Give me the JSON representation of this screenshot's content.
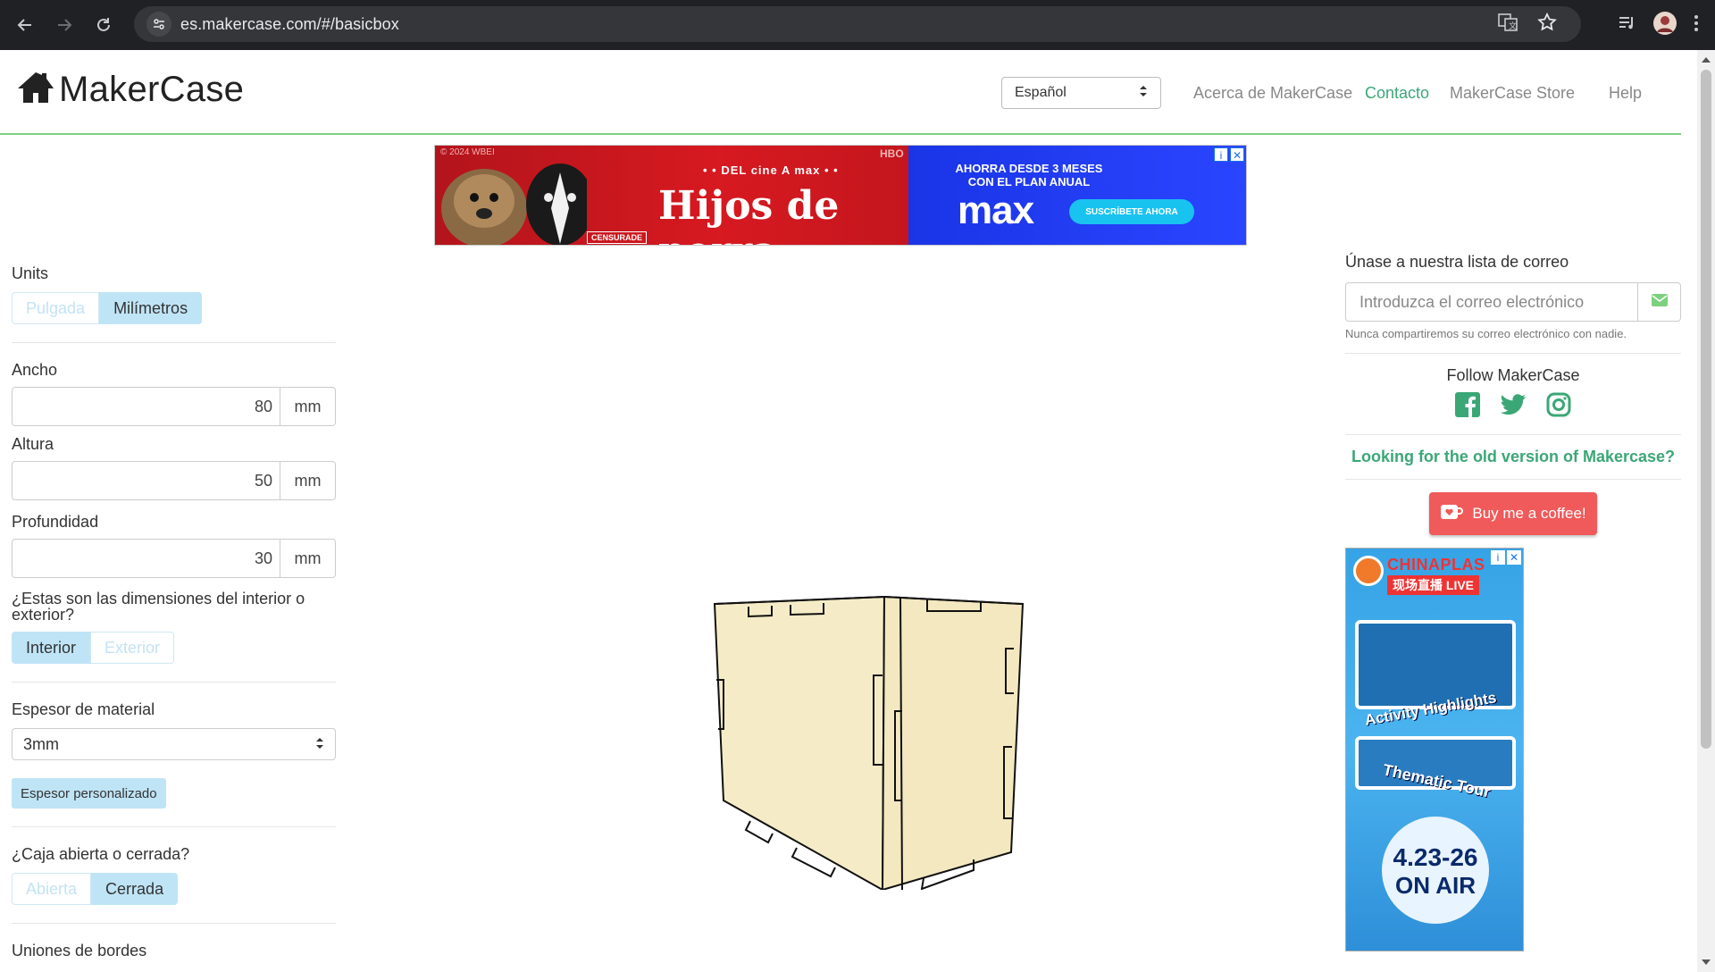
{
  "browser": {
    "url": "es.makercase.com/#/basicbox"
  },
  "header": {
    "logo_text": "MakerCase",
    "language": "Español",
    "nav": [
      {
        "label": "Acerca de MakerCase"
      },
      {
        "label": "Contacto"
      },
      {
        "label": "MakerCase Store"
      },
      {
        "label": "Help"
      }
    ]
  },
  "ad_top": {
    "tag": "© 2024 WBEI",
    "brand_top": "• • DEL cine A max • •",
    "title": "Hijos de perra",
    "stamp": "CENSURADE",
    "hbo": "HBO",
    "offer_line1": "AHORRA DESDE 3 MESES",
    "offer_line2": "CON EL PLAN ANUAL",
    "logo": "max",
    "cta": "SUSCRÍBETE AHORA"
  },
  "left": {
    "units_label": "Units",
    "units": {
      "inch": "Pulgada",
      "mm": "Milímetros"
    },
    "width_label": "Ancho",
    "width_value": "80",
    "height_label": "Altura",
    "height_value": "50",
    "depth_label": "Profundidad",
    "depth_value": "30",
    "unit_suffix": "mm",
    "dims_question": "¿Estas son las dimensiones del interior o exterior?",
    "dims_options": {
      "interior": "Interior",
      "exterior": "Exterior"
    },
    "thickness_label": "Espesor de material",
    "thickness_value": "3mm",
    "custom_thickness": "Espesor personalizado",
    "box_question": "¿Caja abierta o cerrada?",
    "box_options": {
      "open": "Abierta",
      "closed": "Cerrada"
    },
    "edges_label": "Uniones de bordes"
  },
  "right": {
    "mailing_title": "Únase a nuestra lista de correo",
    "email_placeholder": "Introduzca el correo electrónico",
    "email_help": "Nunca compartiremos su correo electrónico con nadie.",
    "follow": "Follow MakerCase",
    "old_version": "Looking for the old version of Makercase?",
    "coffee": "Buy me a coffee!"
  },
  "ad_side": {
    "brand": "CHINAPLAS",
    "live": "现场直播 LIVE",
    "line1": "Activity Highlights",
    "line2": "Thematic Tour",
    "dates": "4.23-26",
    "onair": "ON AIR"
  },
  "colors": {
    "accent_green": "#3ba776",
    "header_border": "#7ed07e",
    "toggle_on": "#bfe4f6",
    "coffee_red": "#f05a5a",
    "box_fill": "#f5ecc7"
  }
}
